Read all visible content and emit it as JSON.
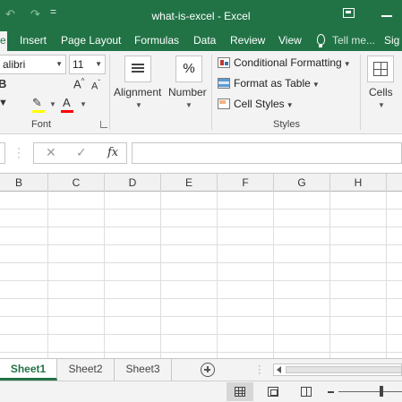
{
  "window": {
    "title": "what-is-excel - Excel",
    "undo_icon": "undo-arrow-icon",
    "redo_icon": "redo-arrow-icon",
    "qat_more": "="
  },
  "tabs": [
    {
      "label": "me",
      "active": true
    },
    {
      "label": "Insert"
    },
    {
      "label": "Page Layout"
    },
    {
      "label": "Formulas"
    },
    {
      "label": "Data"
    },
    {
      "label": "Review"
    },
    {
      "label": "View"
    },
    {
      "label": "Tell me..."
    },
    {
      "label": "Sig"
    }
  ],
  "ribbon": {
    "font_name": "alibri",
    "font_size": "11",
    "grow_font": "A",
    "shrink_font": "A",
    "bold": "B",
    "font_color_label": "A",
    "font_group_label": "Font",
    "alignment_label": "Alignment",
    "number_label": "Number",
    "number_icon": "%",
    "styles": {
      "conditional_formatting": "Conditional Formatting",
      "format_as_table": "Format as Table",
      "cell_styles": "Cell Styles",
      "group_label": "Styles"
    },
    "cells_label": "Cells",
    "highlight_color": "#ffff00",
    "font_color": "#ff0000"
  },
  "formula_bar": {
    "cancel": "✕",
    "enter": "✓",
    "fx": "fx",
    "value": ""
  },
  "columns": [
    "B",
    "C",
    "D",
    "E",
    "F",
    "G",
    "H"
  ],
  "sheets": [
    {
      "label": "Sheet1",
      "active": true
    },
    {
      "label": "Sheet2"
    },
    {
      "label": "Sheet3"
    }
  ],
  "colors": {
    "brand": "#217346",
    "ribbon_bg": "#f3f3f3",
    "gridline": "#dedede"
  }
}
